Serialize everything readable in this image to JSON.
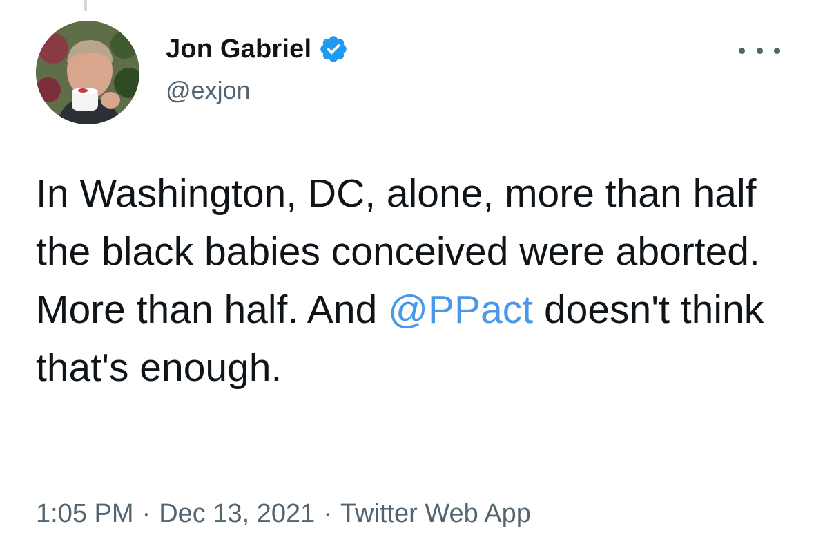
{
  "author": {
    "display_name": "Jon Gabriel",
    "handle": "@exjon",
    "verified": true
  },
  "menu": {
    "more_icon": "more-horizontal-icon"
  },
  "tweet": {
    "text_before_mention": "In Washington, DC, alone, more than half the black babies conceived were aborted. More than half. And ",
    "mention": "@PPact",
    "text_after_mention": " doesn't think that's enough."
  },
  "meta": {
    "time": "1:05 PM",
    "separator": "·",
    "date": "Dec 13, 2021",
    "source": "Twitter Web App"
  },
  "colors": {
    "text": "#0f1419",
    "secondary": "#536471",
    "link": "#4a99e9",
    "verified_badge": "#1d9bf0"
  }
}
